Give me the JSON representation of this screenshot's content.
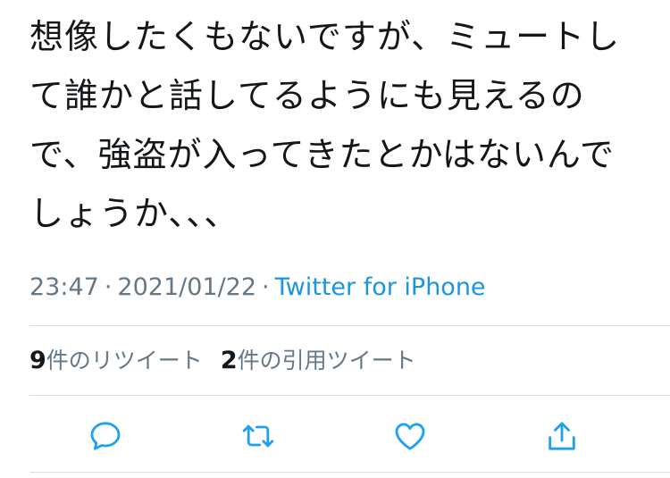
{
  "tweet": {
    "text": "想像したくもないですが、ミュートして誰かと話してるようにも見えるので、強盗が入ってきたとかはないんでしょうか、、、",
    "time": "23:47",
    "separator": "·",
    "date": "2021/01/22",
    "source": "Twitter for iPhone"
  },
  "stats": {
    "retweets_count": "9",
    "retweets_label": "件のリツイート",
    "quotes_count": "2",
    "quotes_label": "件の引用ツイート"
  },
  "actions": {
    "icon_color": "#1da1f2",
    "items": [
      "reply-icon",
      "retweet-icon",
      "like-icon",
      "share-icon"
    ]
  },
  "colors": {
    "text": "#14171a",
    "secondary": "#657786",
    "link": "#1b95e0",
    "divider": "#dadfe2"
  }
}
